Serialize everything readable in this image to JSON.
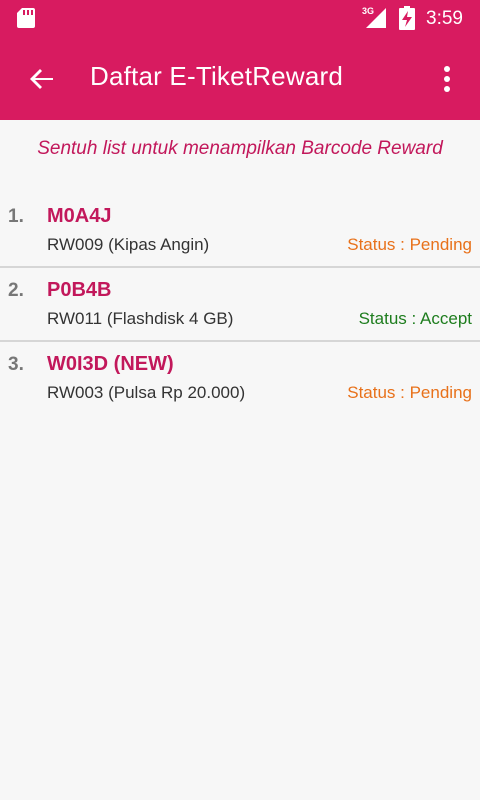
{
  "status_bar": {
    "network": "3G",
    "time": "3:59"
  },
  "app_bar": {
    "title": "Daftar E-TiketReward",
    "back_icon": "arrow-back-icon",
    "menu_icon": "more-vert-icon"
  },
  "hint": "Sentuh list untuk menampilkan Barcode Reward",
  "colors": {
    "primary": "#d81b60",
    "accent_text": "#c2185b",
    "pending": "#e8711a",
    "accept": "#1e7d1e"
  },
  "tickets": [
    {
      "number": "1.",
      "code": "M0A4J",
      "reward": "RW009 (Kipas Angin)",
      "status": "Status : Pending",
      "status_color": "#e8711a"
    },
    {
      "number": "2.",
      "code": "P0B4B",
      "reward": "RW011 (Flashdisk 4 GB)",
      "status": "Status : Accept",
      "status_color": "#1e7d1e"
    },
    {
      "number": "3.",
      "code": "W0I3D (NEW)",
      "reward": "RW003 (Pulsa Rp 20.000)",
      "status": "Status : Pending",
      "status_color": "#e8711a"
    }
  ]
}
